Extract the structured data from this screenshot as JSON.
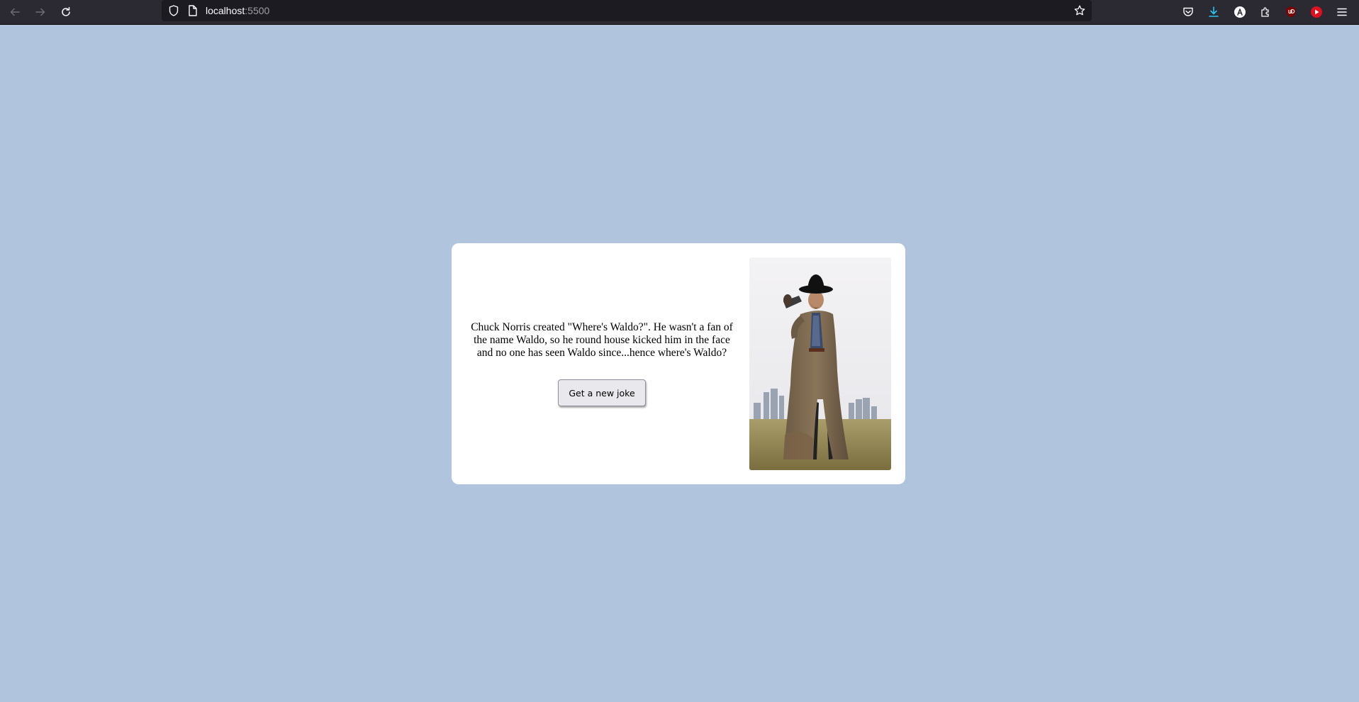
{
  "browser": {
    "url_host": "localhost",
    "url_port": ":5500",
    "bar_color": "#2b2a33",
    "url_bar_color": "#1c1b22"
  },
  "toolbar_icons": [
    "pocket-icon",
    "download-icon",
    "account-icon",
    "extensions-icon",
    "ublock-icon",
    "youtube-addon-icon",
    "menu-icon"
  ],
  "page": {
    "background_color": "#b0c4de",
    "card_color": "#ffffff"
  },
  "joke": {
    "text": "Chuck Norris created \"Where's Waldo?\". He wasn't a fan of the name Waldo, so he round house kicked him in the face and no one has seen Waldo since...hence where's Waldo?",
    "button_label": "Get a new joke"
  },
  "photo": {
    "subject": "chuck-norris-cowboy-photo"
  }
}
